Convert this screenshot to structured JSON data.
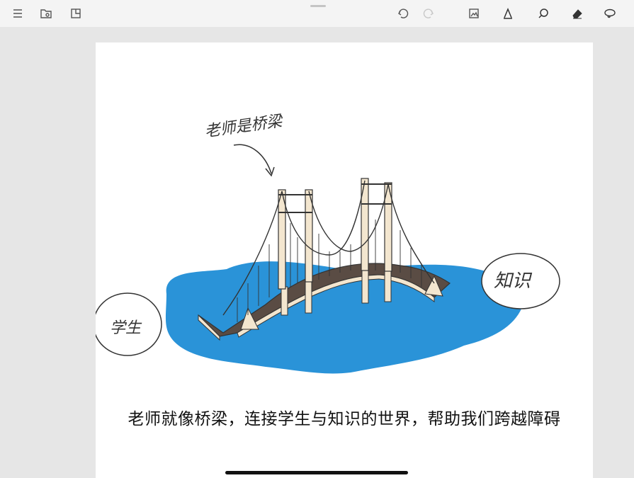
{
  "toolbar": {
    "left_icons": [
      "menu-icon",
      "folder-icon",
      "page-icon"
    ],
    "right_icons": [
      "undo-icon",
      "redo-icon",
      "image-icon",
      "pen-icon",
      "search-icon",
      "eraser-icon",
      "lasso-icon"
    ]
  },
  "drawing": {
    "label_top": "老师是桥梁",
    "label_left": "学生",
    "label_right": "知识"
  },
  "caption": "老师就像桥梁，连接学生与知识的世界，帮助我们跨越障碍",
  "colors": {
    "water": "#2a93d8",
    "deck": "#5a4c44",
    "tower": "#f3e6cf",
    "ink": "#333333"
  }
}
